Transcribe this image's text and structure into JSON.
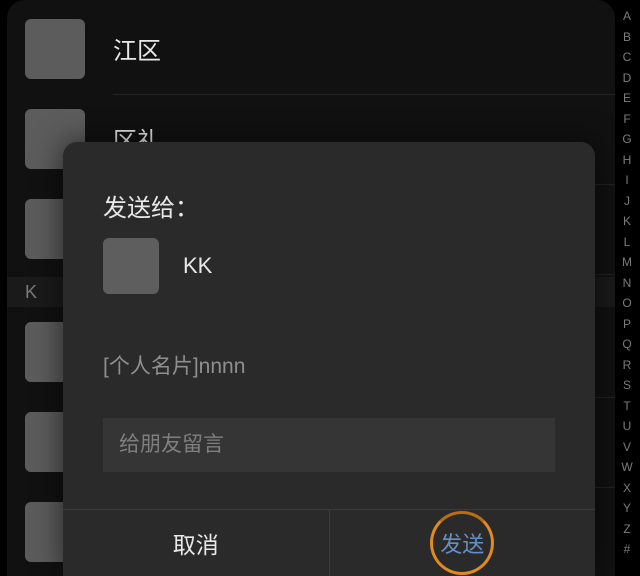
{
  "contacts": {
    "visible": [
      {
        "label": "江区"
      },
      {
        "label": "区礼"
      },
      {
        "label": ""
      },
      {
        "label": ""
      },
      {
        "label": ""
      },
      {
        "label": ""
      }
    ],
    "section_letter": "K"
  },
  "alpha_index": [
    "A",
    "B",
    "C",
    "D",
    "E",
    "F",
    "G",
    "H",
    "I",
    "J",
    "K",
    "L",
    "M",
    "N",
    "O",
    "P",
    "Q",
    "R",
    "S",
    "T",
    "U",
    "V",
    "W",
    "X",
    "Y",
    "Z",
    "#"
  ],
  "modal": {
    "title": "发送给：",
    "recipient": {
      "name": "KK"
    },
    "card_description": "[个人名片]nnnn",
    "message_placeholder": "给朋友留言",
    "cancel_label": "取消",
    "send_label": "发送"
  }
}
